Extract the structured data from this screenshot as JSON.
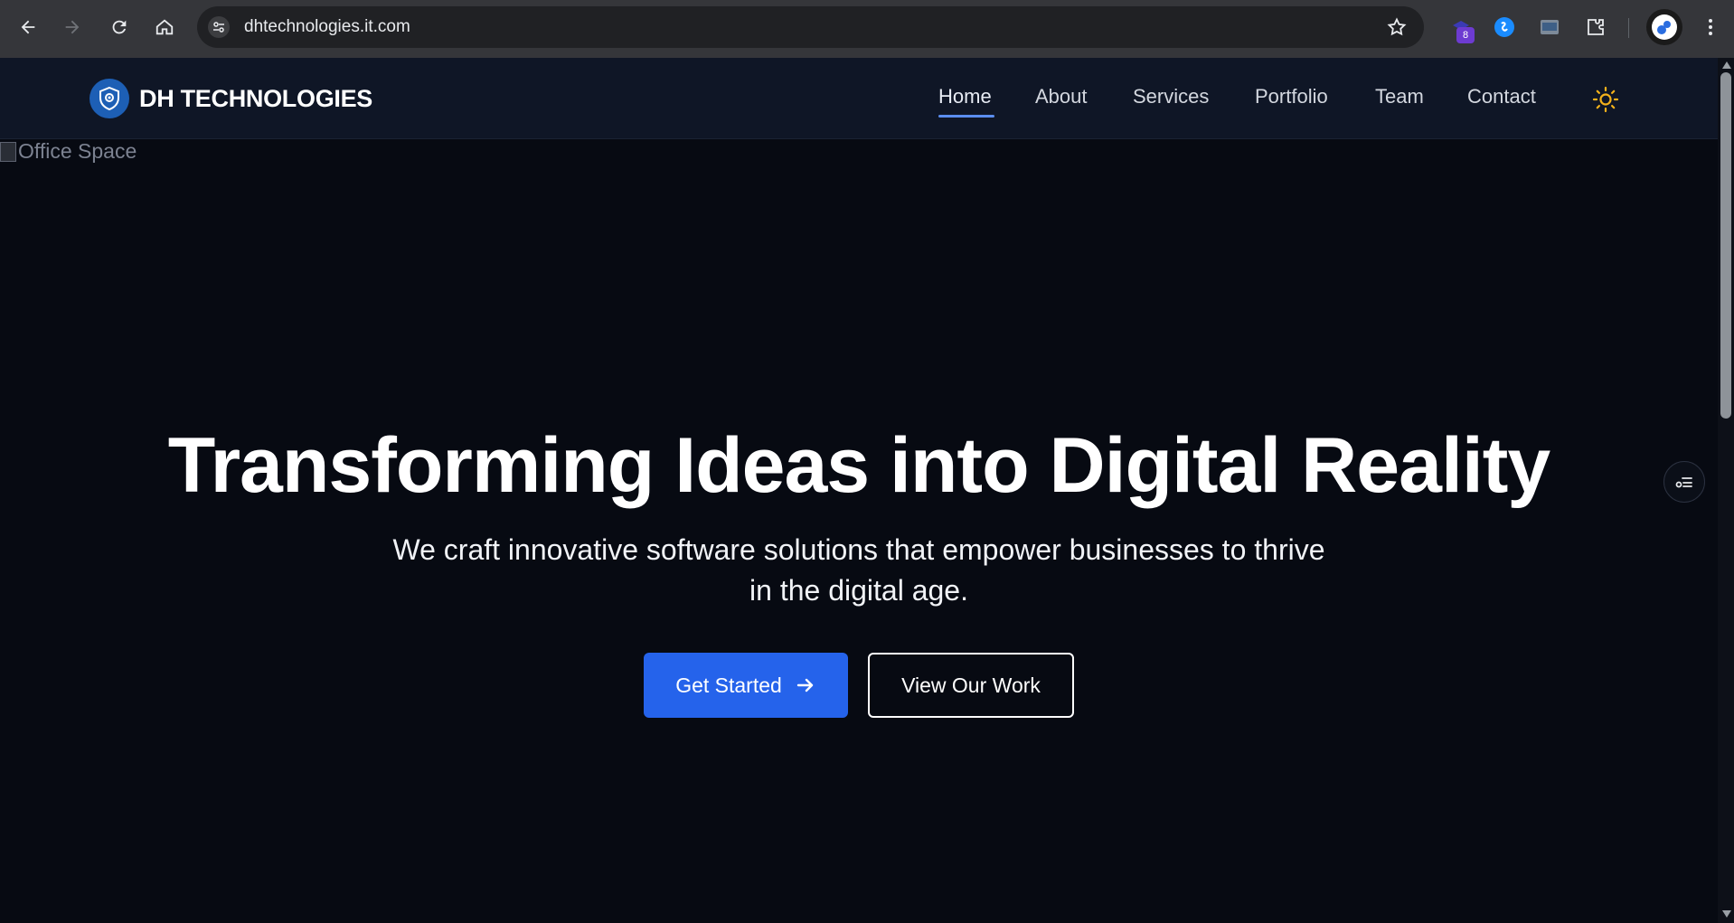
{
  "browser": {
    "url": "dhtechnologies.it.com",
    "extension_badge": "8",
    "icons": [
      "back-icon",
      "forward-icon",
      "reload-icon",
      "home-icon",
      "site-settings-icon",
      "star-icon",
      "extension-icon",
      "shazam-icon",
      "screenshot-icon",
      "puzzle-icon",
      "profile-avatar",
      "kebab-menu-icon"
    ]
  },
  "site": {
    "brand": "DH TECHNOLOGIES",
    "nav": [
      {
        "label": "Home",
        "active": true
      },
      {
        "label": "About"
      },
      {
        "label": "Services"
      },
      {
        "label": "Portfolio"
      },
      {
        "label": "Team"
      },
      {
        "label": "Contact"
      }
    ],
    "theme_icon": "sun-icon"
  },
  "hero": {
    "image_alt": "Office Space",
    "title": "Transforming Ideas into Digital Reality",
    "subtitle": "We craft innovative software solutions that empower businesses to thrive in the digital age.",
    "primary_cta": "Get Started",
    "secondary_cta": "View Our Work"
  },
  "colors": {
    "accent": "#2563eb",
    "nav_bg": "#0f1626",
    "page_bg": "#070a12",
    "sun": "#f5b21b"
  }
}
